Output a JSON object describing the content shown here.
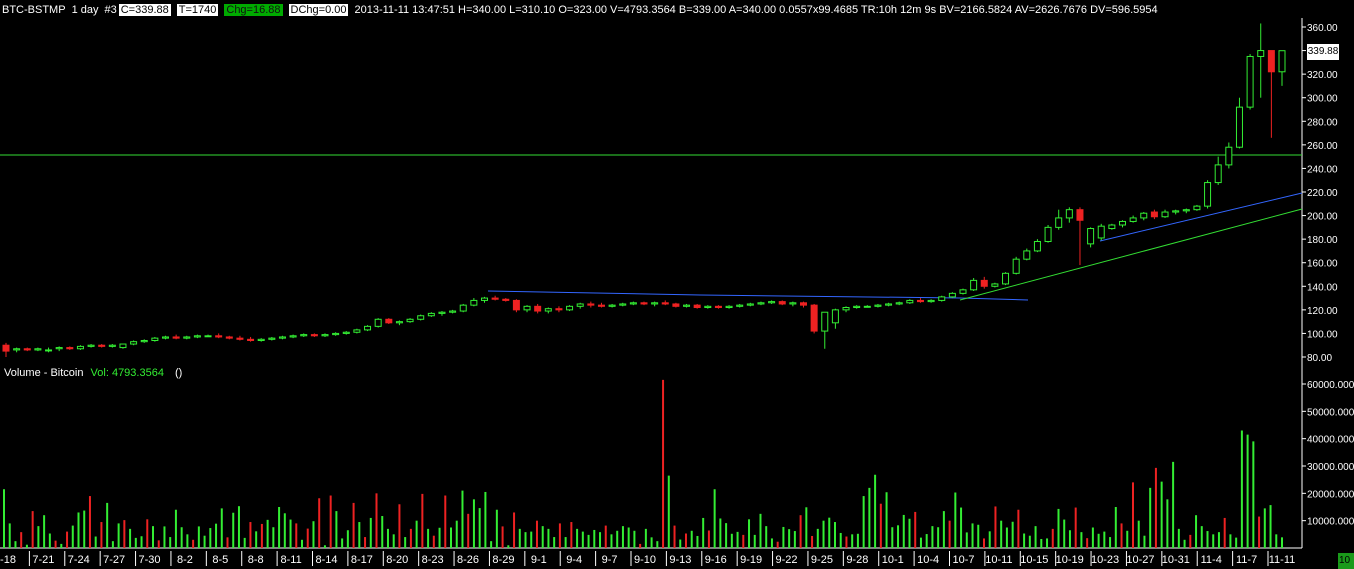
{
  "header": {
    "symbol": "BTC-BSTMP",
    "period": "1 day",
    "number": "#3",
    "close": "C=339.88",
    "trades": "T=1740",
    "change": "Chg=16.88",
    "dchange": "DChg=0.00",
    "stats": "2013-11-11 13:47:51 H=340.00 L=310.10 O=323.00 V=4793.3564 B=339.00 A=340.00 0.0557x99.4685 TR:10h 12m 9s BV=2166.5824 AV=2626.7676 DV=596.5954"
  },
  "volume_header": {
    "label": "Volume - Bitcoin",
    "value": "Vol: 4793.3564",
    "paren": "()"
  },
  "last_price_badge": "339.88",
  "corner_label": "10",
  "colors": {
    "up": "#33ee33",
    "down": "#ee2222",
    "axis": "#ffffff",
    "hline": "#33dd33",
    "blue_line": "#3366ff",
    "bg": "#000000"
  },
  "chart_data": [
    {
      "type": "candlestick",
      "y_ticks": [
        "80.00",
        "100.00",
        "120.00",
        "140.00",
        "160.00",
        "180.00",
        "200.00",
        "220.00",
        "240.00",
        "260.00",
        "280.00",
        "300.00",
        "320.00",
        "340.00",
        "360.00"
      ],
      "ylim": [
        80,
        360
      ],
      "x_labels": [
        "-18",
        "7-21",
        "7-24",
        "7-27",
        "7-30",
        "8-2",
        "8-5",
        "8-8",
        "8-11",
        "8-14",
        "8-17",
        "8-20",
        "8-23",
        "8-26",
        "8-29",
        "9-1",
        "9-4",
        "9-7",
        "9-10",
        "9-13",
        "9-16",
        "9-19",
        "9-22",
        "9-25",
        "9-28",
        "10-1",
        "10-4",
        "10-7",
        "10-11",
        "10-15",
        "10-19",
        "10-23",
        "10-27",
        "10-31",
        "11-4",
        "11-7",
        "11-11"
      ],
      "candles": [
        [
          90,
          92,
          80,
          85
        ],
        [
          86,
          88,
          84,
          87
        ],
        [
          87,
          88,
          85,
          86
        ],
        [
          86,
          88,
          85,
          87
        ],
        [
          86,
          88,
          84,
          86
        ],
        [
          87,
          89,
          85,
          88
        ],
        [
          88,
          89,
          86,
          87
        ],
        [
          87,
          90,
          86,
          89
        ],
        [
          89,
          91,
          88,
          90
        ],
        [
          90,
          91,
          88,
          89
        ],
        [
          89,
          91,
          88,
          90
        ],
        [
          88,
          91,
          87,
          91
        ],
        [
          91,
          94,
          90,
          93
        ],
        [
          93,
          95,
          92,
          94
        ],
        [
          94,
          97,
          93,
          96
        ],
        [
          96,
          98,
          95,
          97
        ],
        [
          97,
          99,
          95,
          96
        ],
        [
          96,
          98,
          95,
          97
        ],
        [
          97,
          99,
          96,
          98
        ],
        [
          98,
          99,
          97,
          98
        ],
        [
          98,
          100,
          96,
          97
        ],
        [
          97,
          98,
          95,
          96
        ],
        [
          96,
          98,
          94,
          95
        ],
        [
          95,
          97,
          93,
          94
        ],
        [
          94,
          96,
          93,
          95
        ],
        [
          95,
          97,
          94,
          96
        ],
        [
          96,
          98,
          95,
          97
        ],
        [
          97,
          99,
          96,
          98
        ],
        [
          98,
          100,
          97,
          99
        ],
        [
          99,
          100,
          97,
          98
        ],
        [
          98,
          100,
          97,
          99
        ],
        [
          99,
          101,
          98,
          100
        ],
        [
          100,
          102,
          99,
          101
        ],
        [
          101,
          104,
          100,
          103
        ],
        [
          103,
          107,
          102,
          106
        ],
        [
          106,
          113,
          105,
          112
        ],
        [
          112,
          113,
          108,
          109
        ],
        [
          109,
          111,
          107,
          110
        ],
        [
          110,
          113,
          109,
          112
        ],
        [
          112,
          116,
          111,
          115
        ],
        [
          115,
          118,
          114,
          117
        ],
        [
          117,
          119,
          115,
          118
        ],
        [
          118,
          120,
          117,
          119
        ],
        [
          119,
          125,
          118,
          124
        ],
        [
          124,
          130,
          123,
          128
        ],
        [
          128,
          131,
          126,
          130
        ],
        [
          130,
          132,
          128,
          129
        ],
        [
          129,
          130,
          127,
          128
        ],
        [
          128,
          129,
          118,
          120
        ],
        [
          120,
          124,
          118,
          123
        ],
        [
          123,
          125,
          117,
          119
        ],
        [
          119,
          122,
          117,
          121
        ],
        [
          121,
          123,
          118,
          120
        ],
        [
          120,
          124,
          119,
          123
        ],
        [
          123,
          126,
          121,
          125
        ],
        [
          125,
          127,
          122,
          124
        ],
        [
          124,
          126,
          122,
          123
        ],
        [
          123,
          125,
          122,
          124
        ],
        [
          124,
          126,
          123,
          125
        ],
        [
          125,
          127,
          124,
          126
        ],
        [
          126,
          127,
          124,
          125
        ],
        [
          125,
          127,
          123,
          126
        ],
        [
          126,
          128,
          124,
          125
        ],
        [
          125,
          126,
          122,
          123
        ],
        [
          123,
          125,
          122,
          124
        ],
        [
          124,
          125,
          121,
          122
        ],
        [
          122,
          124,
          121,
          123
        ],
        [
          123,
          124,
          121,
          122
        ],
        [
          122,
          124,
          121,
          123
        ],
        [
          123,
          125,
          122,
          124
        ],
        [
          124,
          126,
          123,
          125
        ],
        [
          125,
          127,
          124,
          126
        ],
        [
          126,
          128,
          125,
          127
        ],
        [
          127,
          128,
          124,
          125
        ],
        [
          125,
          127,
          123,
          126
        ],
        [
          126,
          127,
          122,
          124
        ],
        [
          124,
          125,
          100,
          102
        ],
        [
          102,
          106,
          87,
          118
        ],
        [
          109,
          121,
          104,
          120
        ],
        [
          120,
          123,
          118,
          122
        ],
        [
          122,
          124,
          121,
          123
        ],
        [
          123,
          124,
          122,
          123
        ],
        [
          123,
          125,
          122,
          124
        ],
        [
          124,
          126,
          123,
          125
        ],
        [
          125,
          127,
          124,
          126
        ],
        [
          126,
          129,
          125,
          128
        ],
        [
          128,
          130,
          126,
          127
        ],
        [
          127,
          129,
          126,
          128
        ],
        [
          128,
          132,
          127,
          131
        ],
        [
          131,
          135,
          130,
          134
        ],
        [
          134,
          138,
          133,
          137
        ],
        [
          137,
          147,
          136,
          145
        ],
        [
          145,
          148,
          138,
          140
        ],
        [
          140,
          143,
          139,
          142
        ],
        [
          142,
          152,
          141,
          151
        ],
        [
          151,
          165,
          150,
          163
        ],
        [
          163,
          172,
          162,
          170
        ],
        [
          170,
          180,
          169,
          178
        ],
        [
          178,
          192,
          177,
          190
        ],
        [
          190,
          205,
          188,
          198
        ],
        [
          198,
          207,
          194,
          205
        ],
        [
          205,
          207,
          158,
          196
        ],
        [
          176,
          190,
          173,
          189
        ],
        [
          181,
          193,
          179,
          191
        ],
        [
          189,
          193,
          188,
          192
        ],
        [
          192,
          196,
          190,
          195
        ],
        [
          195,
          200,
          194,
          198
        ],
        [
          198,
          203,
          196,
          202
        ],
        [
          203,
          205,
          197,
          199
        ],
        [
          199,
          205,
          198,
          203
        ],
        [
          203,
          205,
          201,
          204
        ],
        [
          204,
          206,
          202,
          205
        ],
        [
          205,
          209,
          204,
          208
        ],
        [
          208,
          230,
          206,
          228
        ],
        [
          228,
          250,
          226,
          243
        ],
        [
          243,
          262,
          240,
          258
        ],
        [
          258,
          300,
          257,
          292
        ],
        [
          292,
          337,
          290,
          335
        ],
        [
          335,
          363,
          300,
          340
        ],
        [
          340,
          338,
          266,
          322
        ],
        [
          322,
          340,
          310,
          339.88
        ]
      ]
    },
    {
      "type": "bar",
      "name": "Volume - Bitcoin",
      "y_ticks": [
        "10000.000",
        "20000.000",
        "30000.000",
        "40000.000",
        "50000.000",
        "60000.000"
      ],
      "ylim": [
        0,
        65000
      ],
      "values": [
        21500,
        9000,
        2500,
        5800,
        1200,
        13500,
        8000,
        12000,
        5300,
        2700,
        1500,
        6000,
        8200,
        13000,
        13700,
        19000,
        4200,
        9500,
        16500,
        2500,
        9000,
        10200,
        7000,
        3700,
        4300,
        10500,
        8000,
        2800,
        7900,
        4000,
        14000,
        7600,
        5000,
        3000,
        7900,
        4500,
        7300,
        8900,
        14500,
        3900,
        12900,
        15300,
        3700,
        9500,
        6100,
        8800,
        10300,
        7600,
        15000,
        12700,
        10400,
        9000,
        3000,
        7100,
        9800,
        18200,
        1000,
        19200,
        13500,
        3500,
        6500,
        16500,
        9500,
        4000,
        11000,
        20000,
        11700,
        7000,
        5000,
        16000,
        4000,
        7000,
        10000,
        19800,
        7000,
        4500,
        7400,
        19200,
        7500,
        10000,
        21000,
        12500,
        17800,
        14600,
        20500,
        2500,
        14000,
        7900,
        1000,
        13000,
        7000,
        5800,
        6000,
        10000,
        8000,
        7000,
        4000,
        9000,
        4000,
        9500,
        7000,
        6000,
        4800,
        6600,
        5800,
        8200,
        5000,
        6300,
        8000,
        7500,
        6300,
        1500,
        7000,
        3900,
        2500,
        61500,
        26500,
        8200,
        3100,
        5300,
        6300,
        4400,
        11000,
        6400,
        21500,
        10800,
        9100,
        5200,
        5900,
        4800,
        10500,
        4800,
        12500,
        8000,
        3500,
        2300,
        7700,
        6900,
        6200,
        12000,
        14900,
        4400,
        7000,
        10000,
        11100,
        9500,
        5500,
        4200,
        5000,
        5200,
        19000,
        22000,
        26800,
        16200,
        20400,
        7600,
        8300,
        12100,
        10700,
        13200,
        3800,
        5100,
        8000,
        7600,
        13500,
        10000,
        20300,
        14800,
        5700,
        9000,
        8500,
        3500,
        6100,
        15200,
        10000,
        7500,
        9600,
        14000,
        5300,
        4500,
        8000,
        3300,
        3500,
        7000,
        14300,
        10400,
        6500,
        14800,
        5800,
        3600,
        7500,
        5200,
        6000,
        4000,
        15000,
        9000,
        6300,
        24000,
        10000,
        4500,
        22000,
        29300,
        24300,
        17800,
        31500,
        7000,
        3000,
        4800,
        12000,
        8000,
        6200,
        5000,
        5800,
        11000,
        5000,
        3800,
        43000,
        41500,
        39000,
        11500,
        14500,
        15700,
        5000,
        3900
      ]
    }
  ]
}
